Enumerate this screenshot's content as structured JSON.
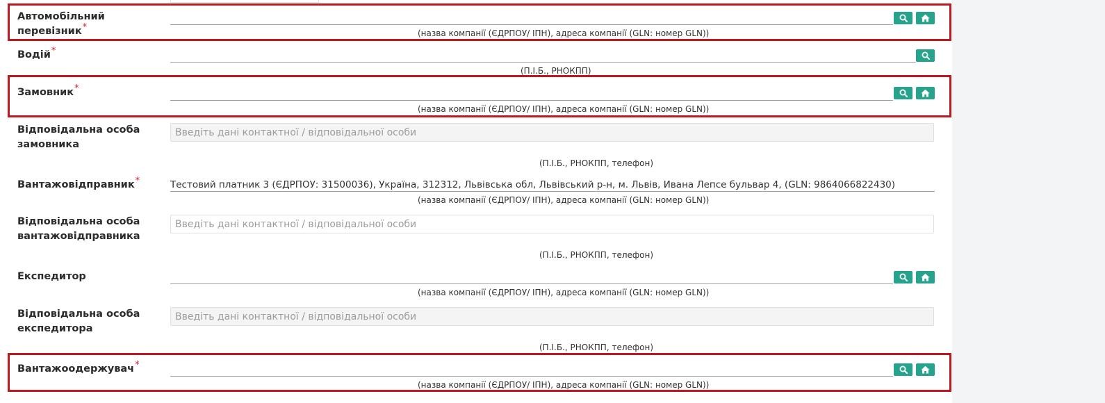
{
  "required_mark": "*",
  "icons": {
    "search": "search-icon",
    "home": "home-icon"
  },
  "colors": {
    "button": "#26a38c",
    "highlight": "#c0181f",
    "required": "#d11f2d"
  },
  "fields": {
    "carrier": {
      "label": "Автомобільний перевізник",
      "hint": "(назва компанії (ЄДРПОУ/ ІПН), адреса компанії (GLN: номер GLN))"
    },
    "driver": {
      "label": "Водій",
      "hint": "(П.І.Б., РНОКПП)"
    },
    "customer": {
      "label": "Замовник",
      "hint": "(назва компанії (ЄДРПОУ/ ІПН), адреса компанії (GLN: номер GLN))"
    },
    "customer_contact": {
      "label_line1": "Відповідальна особа",
      "label_line2": "замовника",
      "placeholder": "Введіть дані контактної / відповідальної особи",
      "hint": "(П.І.Б., РНОКПП, телефон)"
    },
    "shipper": {
      "label": "Вантажовідправник",
      "value": "Тестовий платник 3 (ЄДРПОУ: 31500036), Україна, 312312, Львівська обл, Львівський р-н, м. Львів, Ивана Лепсе бульвар 4, (GLN: 9864066822430)",
      "hint": "(назва компанії (ЄДРПОУ/ ІПН), адреса компанії (GLN: номер GLN))"
    },
    "shipper_contact": {
      "label_line1": "Відповідальна особа",
      "label_line2": "вантажовідправника",
      "placeholder": "Введіть дані контактної / відповідальної особи",
      "hint": "(П.І.Б., РНОКПП, телефон)"
    },
    "forwarder": {
      "label": "Експедитор",
      "hint": "(назва компанії (ЄДРПОУ/ ІПН), адреса компанії (GLN: номер GLN))"
    },
    "forwarder_contact": {
      "label_line1": "Відповідальна особа",
      "label_line2": "експедитора",
      "placeholder": "Введіть дані контактної / відповідальної особи",
      "hint": "(П.І.Б., РНОКПП, телефон)"
    },
    "consignee": {
      "label": "Вантажоодержувач",
      "hint": "(назва компанії (ЄДРПОУ/ ІПН), адреса компанії (GLN: номер GLN))"
    }
  }
}
